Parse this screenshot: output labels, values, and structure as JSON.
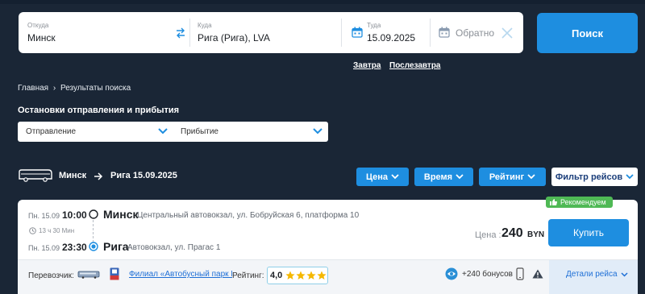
{
  "search": {
    "from_label": "Откуда",
    "from_value": "Минск",
    "to_label": "Куда",
    "to_value": "Рига (Рига), LVA",
    "date_label": "Туда",
    "date_value": "15.09.2025",
    "return_placeholder": "Обратно",
    "search_button": "Поиск"
  },
  "quick_dates": [
    "Завтра",
    "Послезавтра"
  ],
  "breadcrumb": {
    "home": "Главная",
    "separator": "›",
    "current": "Результаты поиска"
  },
  "stops": {
    "title": "Остановки отправления и прибытия",
    "departure": "Отправление",
    "arrival": "Прибытие"
  },
  "route": {
    "from": "Минск",
    "to_date": "Рига 15.09.2025"
  },
  "filters": {
    "price": "Цена",
    "time": "Время",
    "rating": "Рейтинг",
    "filter": "Фильтр рейсов"
  },
  "trip": {
    "badge": "Рекомендуем",
    "dep_date": "Пн. 15.09",
    "dep_time": "10:00",
    "dep_city": "Минск",
    "dep_address": "Центральный автовокзал, ул. Бобруйская 6, платформа 10",
    "duration": "13 ч 30 Мин",
    "arr_date": "Пн. 15.09",
    "arr_time": "23:30",
    "arr_city": "Рига",
    "arr_address": "Автовокзал, ул. Прагас 1",
    "price_label": "Цена :",
    "price_value": "240",
    "currency": "BYN",
    "buy_button": "Купить",
    "carrier_label": "Перевозчик:",
    "carrier_name": "Филиал «Автобусный парк N",
    "rating_label": "Рейтинг:",
    "rating_value": "4,0",
    "stars": 4,
    "bonus": "+240 бонусов",
    "details": "Детали рейса"
  },
  "colors": {
    "background": "#1a2636",
    "accent": "#1e8ee0",
    "badge": "#4fb955",
    "star": "#f5b800"
  }
}
